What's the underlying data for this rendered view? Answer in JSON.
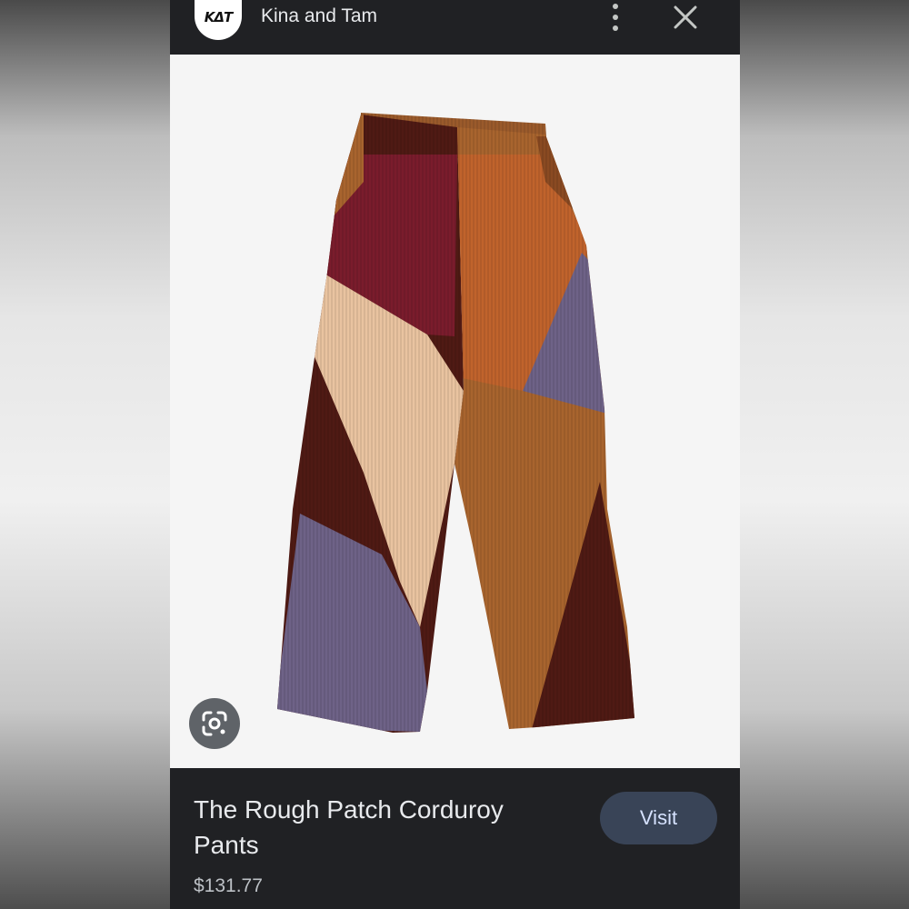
{
  "header": {
    "avatar_text": "KΔT",
    "source_name": "Kina and Tam",
    "more_icon": "more-vert-icon",
    "close_icon": "close-icon"
  },
  "image": {
    "subject": "product-image",
    "lens_icon": "google-lens-icon"
  },
  "product": {
    "title": "The Rough Patch Corduroy Pants",
    "price": "$131.77"
  },
  "actions": {
    "visit_label": "Visit"
  },
  "colors": {
    "panel_background": "#202124",
    "image_background": "#f5f5f5",
    "visit_button": "#394457",
    "visit_text": "#d6e2ff",
    "patch_burgundy": "#7a1c2c",
    "patch_rust": "#c0632c",
    "patch_tan": "#e9c3a0",
    "patch_purple": "#6e6287",
    "patch_chestnut": "#a8642e",
    "patch_maroon": "#4f1a14"
  }
}
